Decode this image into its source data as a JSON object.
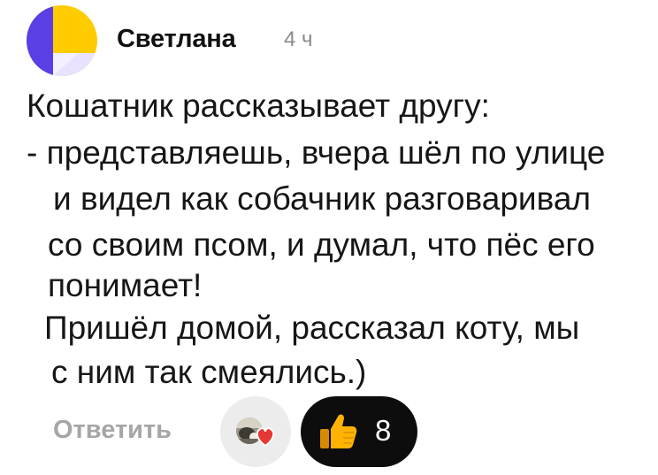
{
  "comment": {
    "author": "Светлана",
    "time": "4 ч",
    "text_lines": [
      "Кошатник рассказывает другу:",
      "- представляешь, вчера шёл по улице",
      "и видел как собачник разговаривал",
      "со своим псом, и  думал, что пёс его",
      "понимает!",
      "Пришёл домой, рассказал коту, мы",
      "с ним так смеялись.)"
    ]
  },
  "actions": {
    "reply_label": "Ответить",
    "likes_count": "8"
  },
  "colors": {
    "avatar_purple": "#5a3ee6",
    "avatar_yellow": "#ffcc00",
    "avatar_lavender": "#e8e2ff",
    "reaction_heart": "#e53935",
    "thumb_yellow": "#ffb300",
    "pill_bg": "#0d0d0d"
  },
  "icons": {
    "avatar": "avatar-icon",
    "reactor": "reactor-avatar-icon",
    "heart": "heart-icon",
    "thumbs_up": "thumbs-up-icon"
  }
}
